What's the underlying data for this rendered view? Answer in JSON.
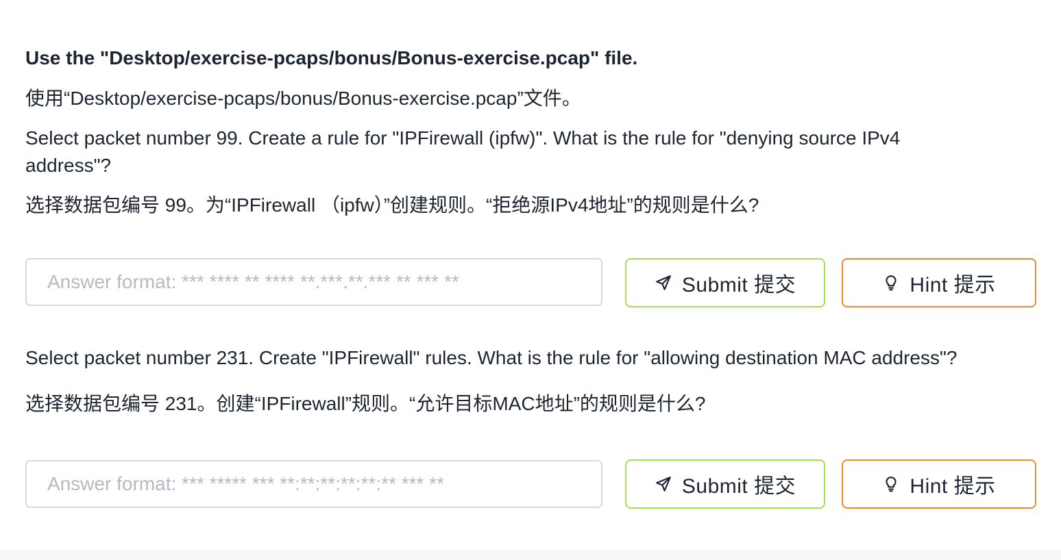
{
  "intro": {
    "file_en": "Use the \"Desktop/exercise-pcaps/bonus/Bonus-exercise.pcap\" file.",
    "file_zh": "使用“Desktop/exercise-pcaps/bonus/Bonus-exercise.pcap”文件。"
  },
  "questions": [
    {
      "text_en": "Select packet number 99. Create a rule for \"IPFirewall (ipfw)\". What is the rule for \"denying source IPv4 address\"?",
      "text_zh": "选择数据包编号 99。为“IPFirewall （ipfw）”创建规则。“拒绝源IPv4地址”的规则是什么?",
      "answer_value": "",
      "answer_placeholder": "Answer format: *** **** ** **** **.***.**.*** ** *** **",
      "submit_label": "Submit  提交",
      "hint_label": "Hint  提示"
    },
    {
      "text_en": "Select packet number 231. Create \"IPFirewall\" rules. What is the rule for \"allowing destination MAC address\"?",
      "text_zh": "选择数据包编号 231。创建“IPFirewall”规则。“允许目标MAC地址”的规则是什么?",
      "answer_value": "",
      "answer_placeholder": "Answer format: *** ***** *** **:**:**:**:**:** *** **",
      "submit_label": "Submit  提交",
      "hint_label": "Hint  提示"
    }
  ],
  "icons": {
    "submit": "paper-plane-icon",
    "hint": "lightbulb-icon"
  },
  "colors": {
    "text": "#1c2430",
    "submit_border": "#a6e04a",
    "hint_border": "#f08a24",
    "input_border": "#d6d9de",
    "placeholder": "#b4bac2"
  }
}
